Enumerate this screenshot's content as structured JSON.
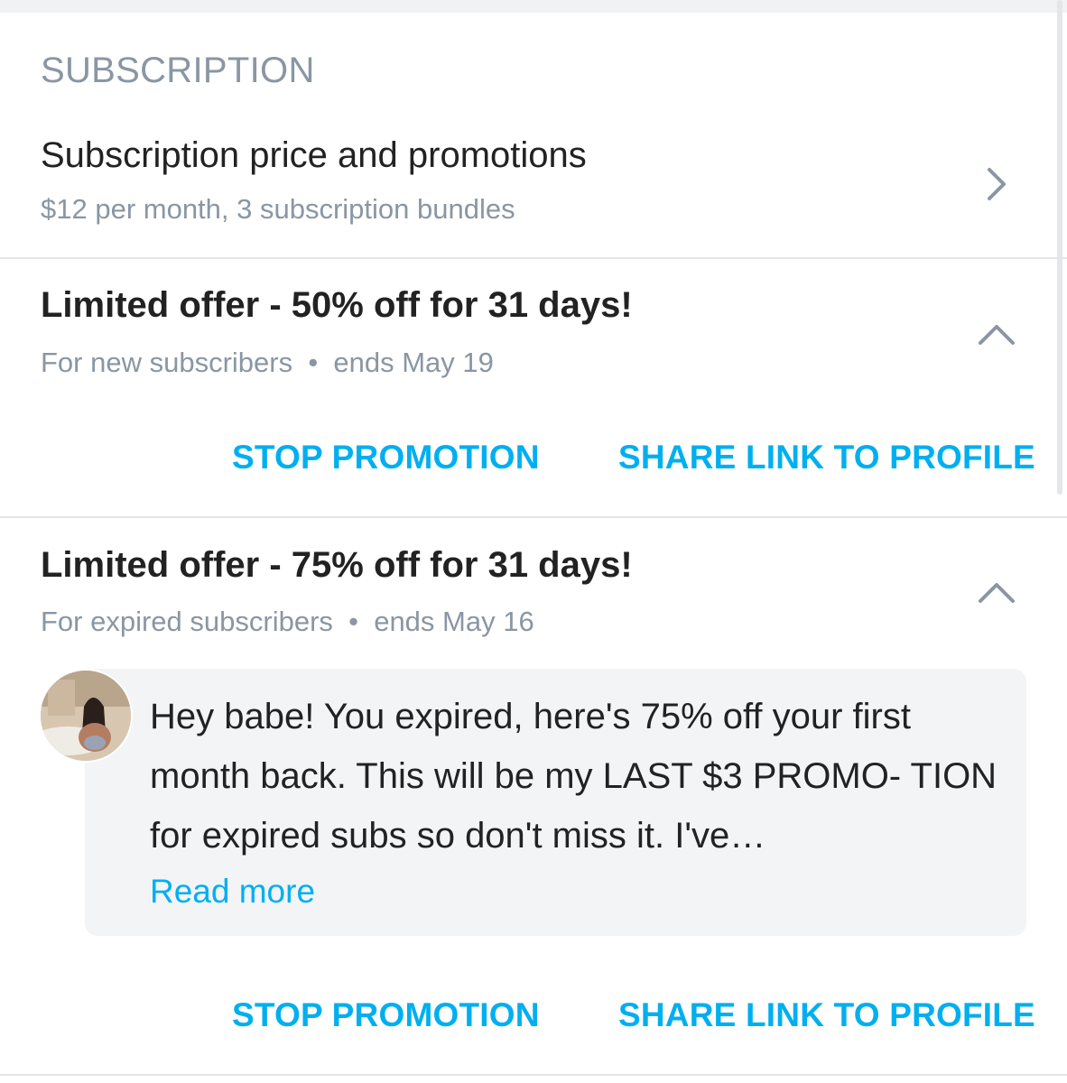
{
  "section": {
    "header": "SUBSCRIPTION"
  },
  "subscription_row": {
    "title": "Subscription price and promotions",
    "subtitle": "$12 per month, 3 subscription bundles",
    "icon": "chevron-right-icon"
  },
  "promotions": [
    {
      "title": "Limited offer - 50% off for 31 days!",
      "meta": "For new subscribers  •  ends May 19",
      "icon": "chevron-up-icon",
      "stop_label": "STOP PROMOTION",
      "share_label": "SHARE LINK TO PROFILE"
    },
    {
      "title": "Limited offer - 75% off for 31 days!",
      "meta": "For expired subscribers  •  ends May 16",
      "icon": "chevron-up-icon",
      "message": "Hey babe! You expired, here's 75% off your first month back. This will be my LAST $3 PROMO- TION for expired subs so don't miss it. I've…",
      "read_more": "Read more",
      "stop_label": "STOP PROMOTION",
      "share_label": "SHARE LINK TO PROFILE"
    }
  ],
  "colors": {
    "accent": "#00aff0",
    "muted_text": "#8a96a3",
    "primary_text": "#222222",
    "divider": "#e3e5e8",
    "message_bg": "#f3f4f6"
  }
}
